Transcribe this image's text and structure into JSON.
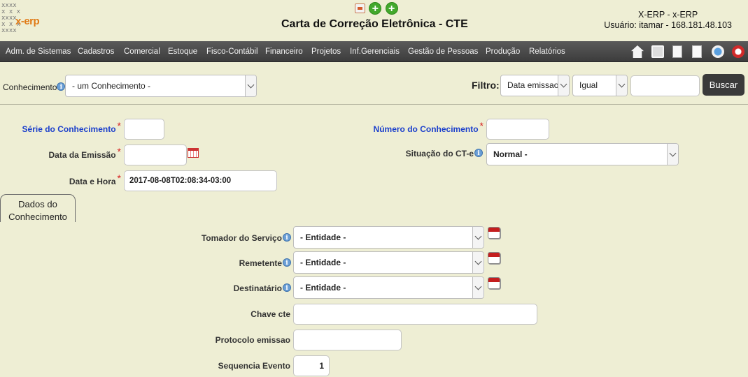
{
  "header": {
    "logo_text": "x-erp",
    "page_title": "Carta de Correção Eletrônica - CTE",
    "system_name": "X-ERP - x-ERP",
    "user_info": "Usuário: itamar - 168.181.48.103",
    "icons": [
      "document-icon",
      "add-icon",
      "add-icon"
    ]
  },
  "menu": {
    "items": [
      "Adm. de Sistemas",
      "Cadastros",
      "Comercial",
      "Estoque",
      "Fisco-Contábil",
      "Financeiro",
      "Projetos",
      "Inf.Gerenciais",
      "Gestão de Pessoas",
      "Produção",
      "Relatórios"
    ],
    "toolbar_icons": [
      "home-icon",
      "print-icon",
      "page-icon",
      "document-icon",
      "help-icon",
      "exit-icon"
    ]
  },
  "filter": {
    "conhecimento_label": "Conhecimento",
    "conhecimento_value": "- um Conhecimento -",
    "filtro_label": "Filtro:",
    "field_value": "Data emissao",
    "operator_value": "Igual",
    "search_value": "",
    "buscar_label": "Buscar"
  },
  "form": {
    "serie_label": "Série do Conhecimento",
    "serie_value": "",
    "numero_label": "Número do Conhecimento",
    "numero_value": "",
    "data_emissao_label": "Data da Emissão",
    "data_emissao_value": "",
    "situacao_label": "Situação do CT-e",
    "situacao_value": "Normal -",
    "data_hora_label": "Data e Hora",
    "data_hora_value": "2017-08-08T02:08:34-03:00",
    "required_mark": "*"
  },
  "tab": {
    "label_line1": "Dados do",
    "label_line2": "Conhecimento"
  },
  "details": {
    "tomador_label": "Tomador do Serviço",
    "tomador_value": "- Entidade -",
    "remetente_label": "Remetente",
    "remetente_value": "- Entidade -",
    "destinatario_label": "Destinatário",
    "destinatario_value": "- Entidade -",
    "chave_label": "Chave cte",
    "chave_value": "",
    "protocolo_label": "Protocolo emissao",
    "protocolo_value": "",
    "sequencia_label": "Sequencia Evento",
    "sequencia_value": "1"
  },
  "colors": {
    "background": "#eeeed4",
    "menubar": "#464646",
    "required": "#d62020",
    "blue_label": "#1b3fcc"
  }
}
